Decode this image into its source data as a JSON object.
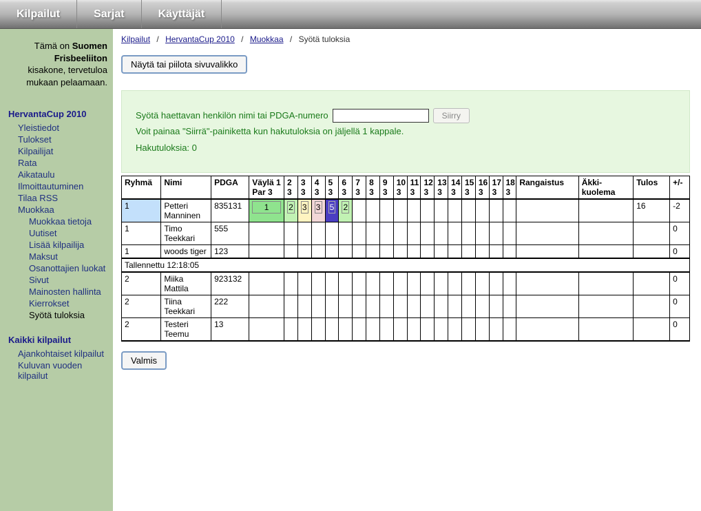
{
  "topnav": [
    "Kilpailut",
    "Sarjat",
    "Käyttäjät"
  ],
  "welcome": {
    "line1a": "Tämä on ",
    "line1b": "Suomen",
    "line2": "Frisbeeliiton",
    "line3": "kisakone, tervetuloa",
    "line4": "mukaan pelaamaan."
  },
  "sidebar": {
    "section1_head": "HervantaCup 2010",
    "links1": [
      "Yleistiedot",
      "Tulokset",
      "Kilpailijat",
      "Rata",
      "Aikataulu",
      "Ilmoittautuminen",
      "Tilaa RSS",
      "Muokkaa"
    ],
    "sub": [
      "Muokkaa tietoja",
      "Uutiset",
      "Lisää kilpailija",
      "Maksut",
      "Osanottajien luokat",
      "Sivut",
      "Mainosten hallinta",
      "Kierrokset"
    ],
    "current": "Syötä tuloksia",
    "section2_head": "Kaikki kilpailut",
    "links2": [
      "Ajankohtaiset kilpailut",
      "Kuluvan vuoden kilpailut"
    ]
  },
  "breadcrumb": {
    "items": [
      "Kilpailut",
      "HervantaCup 2010",
      "Muokkaa"
    ],
    "current": "Syötä tuloksia"
  },
  "toggle_btn": "Näytä tai piilota sivuvalikko",
  "search": {
    "prompt": "Syötä haettavan henkilön nimi tai PDGA-numero",
    "go": "Siirry",
    "hint": "Voit painaa \"Siirrä\"-painiketta kun hakutuloksia on jäljellä 1 kappale.",
    "count_label": "Hakutuloksia:",
    "count": "0"
  },
  "headers": {
    "ryhma": "Ryhmä",
    "nimi": "Nimi",
    "pdga": "PDGA",
    "hole1": "Väylä 1 Par 3",
    "holes": [
      "2 3",
      "3 3",
      "4 3",
      "5 3",
      "6 3",
      "7 3",
      "8 3",
      "9 3",
      "10 3",
      "11 3",
      "12 3",
      "13 3",
      "14 3",
      "15 3",
      "16 3",
      "17 3",
      "18 3"
    ],
    "rang": "Rangaistus",
    "akki": "Äkki-kuolema",
    "tulos": "Tulos",
    "pm": "+/-"
  },
  "group1": [
    {
      "ryhma": "1",
      "nimi": "Petteri Manninen",
      "pdga": "835131",
      "scores": [
        "1",
        "2",
        "3",
        "3",
        "5",
        "2",
        "",
        "",
        "",
        "",
        "",
        "",
        "",
        "",
        "",
        "",
        "",
        ""
      ],
      "rang": "",
      "akki": "",
      "tulos": "16",
      "pm": "-2",
      "selected": true
    },
    {
      "ryhma": "1",
      "nimi": "Timo Teekkari",
      "pdga": "555",
      "scores": [
        "",
        "",
        "",
        "",
        "",
        "",
        "",
        "",
        "",
        "",
        "",
        "",
        "",
        "",
        "",
        "",
        "",
        ""
      ],
      "rang": "",
      "akki": "",
      "tulos": "",
      "pm": "0"
    },
    {
      "ryhma": "1",
      "nimi": "woods tiger",
      "pdga": "123",
      "scores": [
        "",
        "",
        "",
        "",
        "",
        "",
        "",
        "",
        "",
        "",
        "",
        "",
        "",
        "",
        "",
        "",
        "",
        ""
      ],
      "rang": "",
      "akki": "",
      "tulos": "",
      "pm": "0"
    }
  ],
  "saved_text": "Tallennettu 12:18:05",
  "group2": [
    {
      "ryhma": "2",
      "nimi": "Miika Mattila",
      "pdga": "923132",
      "scores": [
        "",
        "",
        "",
        "",
        "",
        "",
        "",
        "",
        "",
        "",
        "",
        "",
        "",
        "",
        "",
        "",
        "",
        ""
      ],
      "rang": "",
      "akki": "",
      "tulos": "",
      "pm": "0"
    },
    {
      "ryhma": "2",
      "nimi": "Tiina Teekkari",
      "pdga": "222",
      "scores": [
        "",
        "",
        "",
        "",
        "",
        "",
        "",
        "",
        "",
        "",
        "",
        "",
        "",
        "",
        "",
        "",
        "",
        ""
      ],
      "rang": "",
      "akki": "",
      "tulos": "",
      "pm": "0"
    },
    {
      "ryhma": "2",
      "nimi": "Testeri Teemu",
      "pdga": "13",
      "scores": [
        "",
        "",
        "",
        "",
        "",
        "",
        "",
        "",
        "",
        "",
        "",
        "",
        "",
        "",
        "",
        "",
        "",
        ""
      ],
      "rang": "",
      "akki": "",
      "tulos": "",
      "pm": "0"
    }
  ],
  "valmis": "Valmis"
}
